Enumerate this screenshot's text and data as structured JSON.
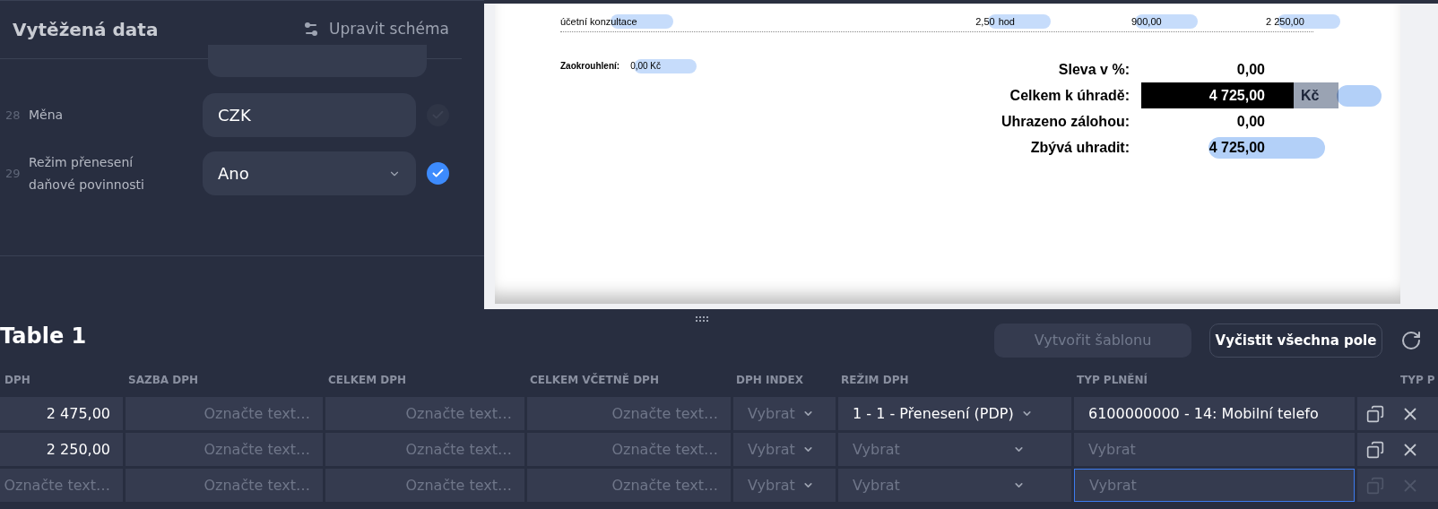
{
  "extraction_panel": {
    "title": "Vytěžená data",
    "edit_schema": "Upravit schéma",
    "fields": [
      {
        "number": "28",
        "label": "Měna",
        "value": "CZK",
        "kind": "text",
        "confirmed": false
      },
      {
        "number": "29",
        "label": "Režim přenesení daňové povinnosti",
        "value": "Ano",
        "kind": "select",
        "confirmed": true
      }
    ]
  },
  "document": {
    "line_item": [
      {
        "text": "účetní konzultace",
        "highlighted": true
      },
      {
        "text": "2,50",
        "highlighted": false
      },
      {
        "text": "hod",
        "highlighted": true
      },
      {
        "text": "900,00",
        "highlighted": true
      },
      {
        "text": "2 250,00",
        "highlighted": true
      }
    ],
    "rounding": {
      "label": "Zaokrouhlení:",
      "value": "0,00 Kč",
      "highlighted": true
    },
    "summary": [
      {
        "label": "Sleva v %:",
        "value": "0,00",
        "highlighted": false,
        "selected": false
      },
      {
        "label": "Celkem k úhradě:",
        "value": "4 725,00",
        "currency": "Kč",
        "highlighted": true,
        "selected": true
      },
      {
        "label": "Uhrazeno zálohou:",
        "value": "0,00",
        "highlighted": false,
        "selected": false
      },
      {
        "label": "Zbývá uhradit:",
        "value": "4 725,00",
        "highlighted": true,
        "selected": false
      }
    ]
  },
  "table": {
    "title": "Table 1",
    "buttons": [
      {
        "label": "Vytvořit šablonu",
        "disabled": true
      },
      {
        "label": "Vyčistit všechna pole",
        "disabled": false
      }
    ],
    "columns": [
      "DPH",
      "SAZBA DPH",
      "CELKEM DPH",
      "CELKEM VČETNĚ DPH",
      "DPH INDEX",
      "REŽIM DPH",
      "TYP PLNĚNÍ",
      "TYP P"
    ],
    "rows": [
      {
        "actions_disabled": false,
        "cells": [
          {
            "kind": "text",
            "value": "2 475,00"
          },
          {
            "kind": "text",
            "placeholder": "Označte text…"
          },
          {
            "kind": "text",
            "placeholder": "Označte text…"
          },
          {
            "kind": "text",
            "placeholder": "Označte text…"
          },
          {
            "kind": "select",
            "placeholder": "Vybrat"
          },
          {
            "kind": "select",
            "value": "1 - 1 - Přenesení (PDP)"
          },
          {
            "kind": "combo",
            "value": "6100000000 - 14: Mobilní telefo",
            "focused": false
          }
        ]
      },
      {
        "actions_disabled": false,
        "cells": [
          {
            "kind": "text",
            "value": "2 250,00"
          },
          {
            "kind": "text",
            "placeholder": "Označte text…"
          },
          {
            "kind": "text",
            "placeholder": "Označte text…"
          },
          {
            "kind": "text",
            "placeholder": "Označte text…"
          },
          {
            "kind": "select",
            "placeholder": "Vybrat"
          },
          {
            "kind": "wideselect",
            "placeholder": "Vybrat"
          },
          {
            "kind": "combo",
            "placeholder": "Vybrat",
            "focused": false
          }
        ]
      },
      {
        "actions_disabled": true,
        "cells": [
          {
            "kind": "text",
            "placeholder": "Označte text…"
          },
          {
            "kind": "text",
            "placeholder": "Označte text…"
          },
          {
            "kind": "text",
            "placeholder": "Označte text…"
          },
          {
            "kind": "text",
            "placeholder": "Označte text…"
          },
          {
            "kind": "select",
            "placeholder": "Vybrat"
          },
          {
            "kind": "wideselect",
            "placeholder": "Vybrat"
          },
          {
            "kind": "combo",
            "placeholder": "Vybrat",
            "focused": true
          }
        ]
      }
    ]
  }
}
